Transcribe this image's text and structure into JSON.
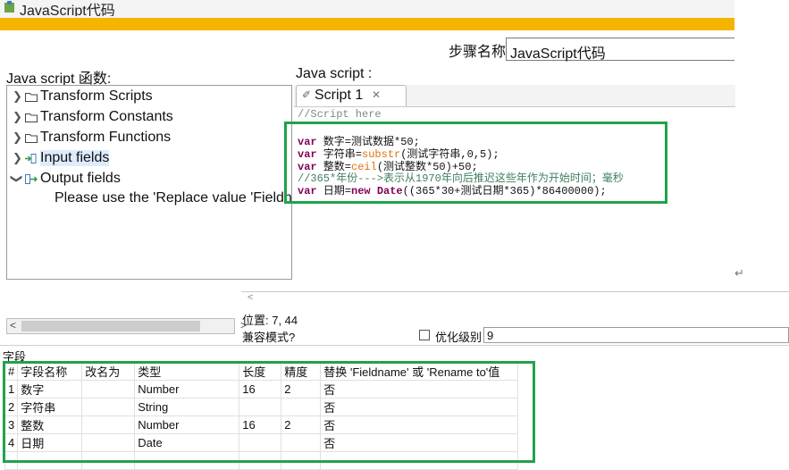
{
  "window": {
    "title": "JavaScript代码"
  },
  "step": {
    "label": "步骤名称",
    "value": "JavaScript代码"
  },
  "left_panel": {
    "title": "Java script 函数:",
    "tree": [
      {
        "label": "Transform Scripts",
        "expanded": false,
        "icon": "folder-icon"
      },
      {
        "label": "Transform Constants",
        "expanded": false,
        "icon": "folder-icon"
      },
      {
        "label": "Transform Functions",
        "expanded": false,
        "icon": "folder-icon"
      },
      {
        "label": "Input fields",
        "expanded": false,
        "icon": "input-fields-icon",
        "selected": true
      },
      {
        "label": "Output fields",
        "expanded": true,
        "icon": "output-fields-icon"
      }
    ],
    "output_child": "Please use the 'Replace value 'Fieldname'"
  },
  "editor": {
    "title": "Java script :",
    "tab": {
      "label": "Script 1",
      "close": "✕"
    },
    "lines": [
      "//Script here",
      "",
      "var 数字=测试数据*50;",
      "var 字符串=substr(测试字符串,0,5);",
      "var 整数=ceil(测试整数*50)+50;",
      "//365*年份--->表示从1970年向后推迟这些年作为开始时间；毫秒",
      "var 日期=new Date((365*30+测试日期*365)*86400000);"
    ]
  },
  "status": {
    "position_label": "位置: 7, 44",
    "compat_label": "兼容模式?",
    "optimize_label": "优化级别",
    "optimize_value": "9"
  },
  "fields": {
    "section_label": "字段",
    "headers": [
      "#",
      "字段名称",
      "改名为",
      "类型",
      "长度",
      "精度",
      "替换 'Fieldname' 或 'Rename to'值"
    ],
    "rows": [
      [
        "1",
        "数字",
        "",
        "Number",
        "16",
        "2",
        "否"
      ],
      [
        "2",
        "字符串",
        "",
        "String",
        "",
        "",
        "否"
      ],
      [
        "3",
        "整数",
        "",
        "Number",
        "16",
        "2",
        "否"
      ],
      [
        "4",
        "日期",
        "",
        "Date",
        "",
        "",
        "否"
      ]
    ]
  },
  "colors": {
    "accent_bar": "#f5b400",
    "highlight_box": "#1fa34a",
    "keyword": "#7f0055",
    "function": "#e07010",
    "comment": "#3f7f5f"
  }
}
